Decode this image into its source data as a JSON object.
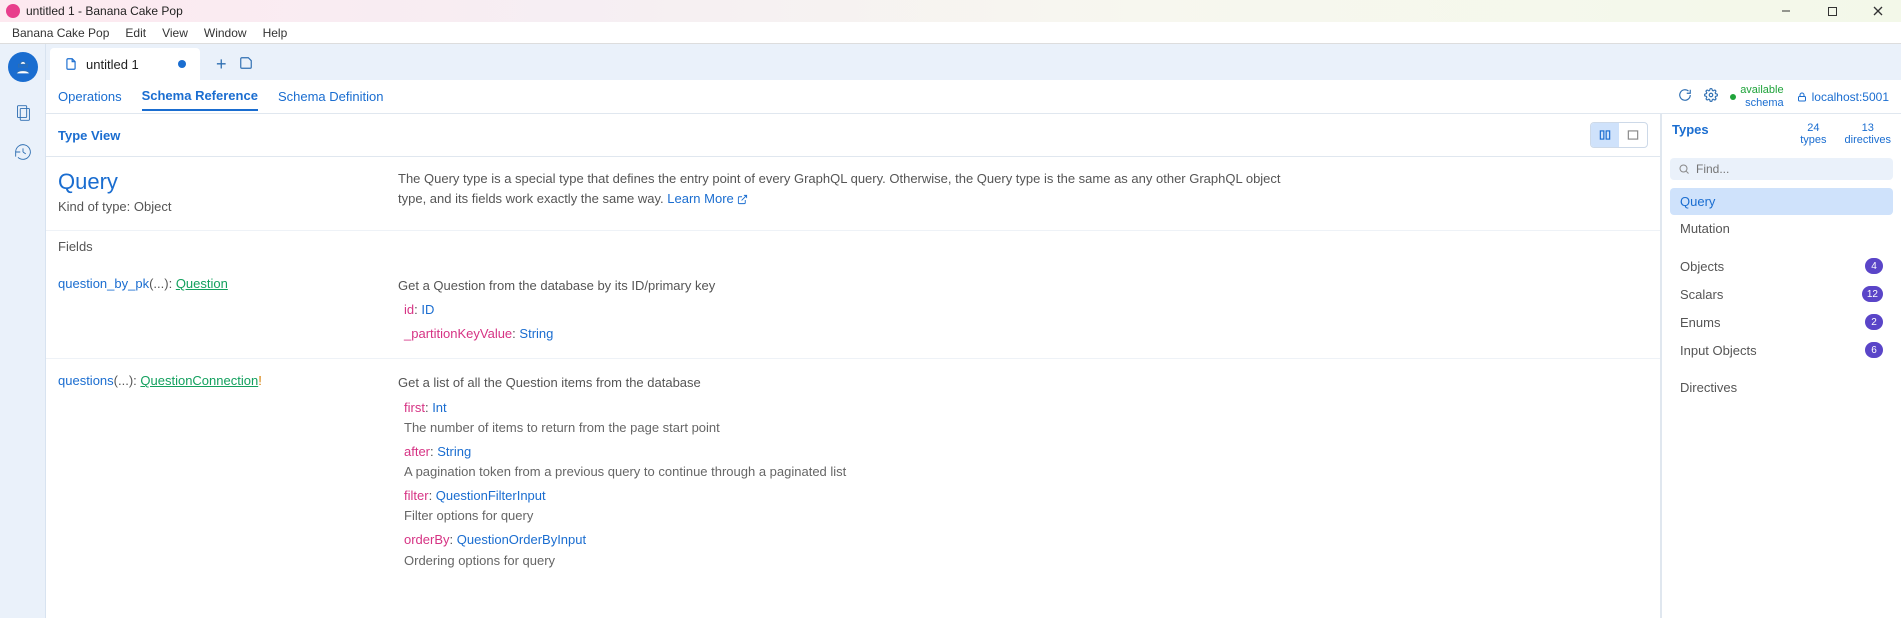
{
  "window": {
    "title": "untitled 1 - Banana Cake Pop"
  },
  "menu": {
    "app": "Banana Cake Pop",
    "edit": "Edit",
    "view": "View",
    "window": "Window",
    "help": "Help"
  },
  "tab": {
    "name": "untitled 1"
  },
  "subtabs": {
    "operations": "Operations",
    "schema_reference": "Schema Reference",
    "schema_definition": "Schema Definition"
  },
  "status": {
    "available": "available",
    "schema": "schema",
    "host": "localhost:5001"
  },
  "typeview": {
    "label": "Type View"
  },
  "type": {
    "name": "Query",
    "kind": "Kind of type: Object",
    "desc": "The Query type is a special type that defines the entry point of every GraphQL query. Otherwise, the Query type is the same as any other GraphQL object type, and its fields work exactly the same way.",
    "learn_more": "Learn More",
    "fields_label": "Fields"
  },
  "fields": {
    "f0": {
      "name": "question_by_pk",
      "args_text": "(...):",
      "ret": "Question",
      "desc": "Get a Question from the database by its ID/primary key",
      "a0": {
        "name": "id",
        "type": "ID"
      },
      "a1": {
        "name": "_partitionKeyValue",
        "type": "String"
      }
    },
    "f1": {
      "name": "questions",
      "args_text": "(...):",
      "ret": "QuestionConnection",
      "bang": "!",
      "desc": "Get a list of all the Question items from the database",
      "a0": {
        "name": "first",
        "type": "Int",
        "desc": "The number of items to return from the page start point"
      },
      "a1": {
        "name": "after",
        "type": "String",
        "desc": "A pagination token from a previous query to continue through a paginated list"
      },
      "a2": {
        "name": "filter",
        "type": "QuestionFilterInput",
        "desc": "Filter options for query"
      },
      "a3": {
        "name": "orderBy",
        "type": "QuestionOrderByInput",
        "desc": "Ordering options for query"
      }
    }
  },
  "right": {
    "types_label": "Types",
    "count_types": "24",
    "count_types_label": "types",
    "count_dirs": "13",
    "count_dirs_label": "directives",
    "search_placeholder": "Find...",
    "items": {
      "query": "Query",
      "mutation": "Mutation",
      "objects": "Objects",
      "objects_n": "4",
      "scalars": "Scalars",
      "scalars_n": "12",
      "enums": "Enums",
      "enums_n": "2",
      "input_objects": "Input Objects",
      "input_objects_n": "6",
      "directives": "Directives"
    }
  }
}
